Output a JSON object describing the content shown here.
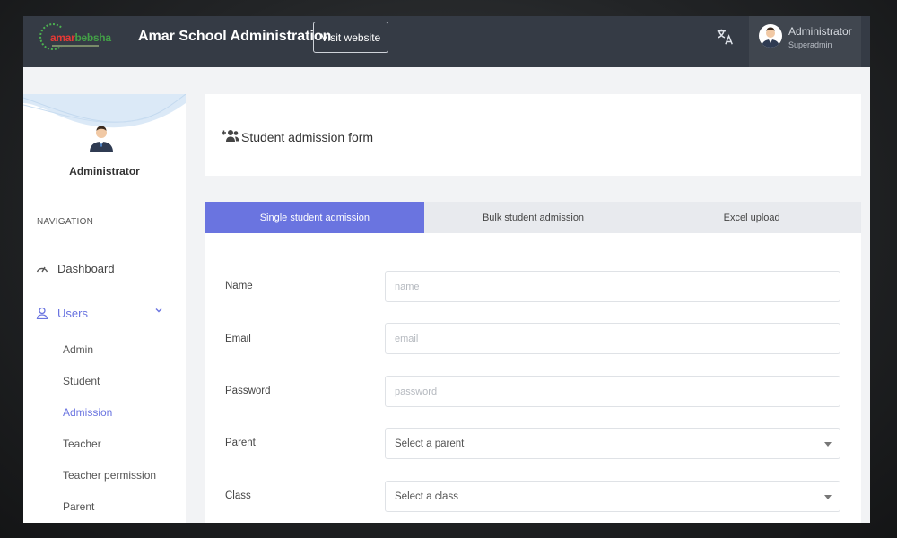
{
  "header": {
    "logo_text_a": "amar",
    "logo_text_b": "bebsha",
    "app_title": "Amar School Administration",
    "visit_label": "Visit website",
    "user_name": "Administrator",
    "user_role": "Superadmin"
  },
  "sidebar": {
    "profile_name": "Administrator",
    "nav_heading": "NAVIGATION",
    "items": [
      {
        "label": "Dashboard",
        "icon": "gauge-icon"
      },
      {
        "label": "Users",
        "icon": "user-icon"
      }
    ],
    "sub_items": [
      "Admin",
      "Student",
      "Admission",
      "Teacher",
      "Teacher permission",
      "Parent"
    ],
    "active_sub_item": "Admission"
  },
  "page": {
    "title": "Student admission form",
    "title_icon": "user-add-icon"
  },
  "tabs": [
    "Single student admission",
    "Bulk student admission",
    "Excel upload"
  ],
  "active_tab": "Single student admission",
  "form": {
    "name_label": "Name",
    "name_placeholder": "name",
    "email_label": "Email",
    "email_placeholder": "email",
    "password_label": "Password",
    "password_placeholder": "password",
    "parent_label": "Parent",
    "parent_value": "Select a parent",
    "class_label": "Class",
    "class_value": "Select a class"
  },
  "colors": {
    "accent": "#6a74e0",
    "topbar": "#353b45"
  }
}
